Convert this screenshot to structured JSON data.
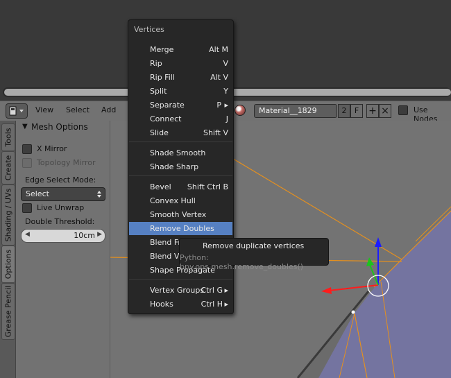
{
  "header": {
    "view_label": "View",
    "select_label": "Select",
    "add_label": "Add",
    "material_name": "Material__1829",
    "material_users": "2",
    "fake_user": "F",
    "new_material": "+",
    "unlink": "×",
    "use_nodes_label": "Use Nodes"
  },
  "tabs": [
    "Tools",
    "Create",
    "Shading / UVs",
    "Options",
    "Grease Pencil"
  ],
  "tool_panel": {
    "panel_title": "Mesh Options",
    "x_mirror": "X Mirror",
    "topology_mirror": "Topology Mirror",
    "edge_select_label": "Edge Select Mode:",
    "edge_select_value": "Select",
    "live_unwrap": "Live Unwrap",
    "double_threshold_label": "Double Threshold:",
    "double_threshold_value": "10cm"
  },
  "menu": {
    "title": "Vertices",
    "items": [
      {
        "label": "Merge",
        "shortcut": "Alt M"
      },
      {
        "label": "Rip",
        "shortcut": "V"
      },
      {
        "label": "Rip Fill",
        "shortcut": "Alt V"
      },
      {
        "label": "Split",
        "shortcut": "Y"
      },
      {
        "label": "Separate",
        "shortcut": "P"
      },
      {
        "label": "Connect",
        "shortcut": "J"
      },
      {
        "label": "Slide",
        "shortcut": "Shift V"
      },
      {
        "label": "Shade Smooth",
        "shortcut": ""
      },
      {
        "label": "Shade Sharp",
        "shortcut": ""
      },
      {
        "label": "Bevel",
        "shortcut": "Shift Ctrl B"
      },
      {
        "label": "Convex Hull",
        "shortcut": ""
      },
      {
        "label": "Smooth Vertex",
        "shortcut": ""
      },
      {
        "label": "Remove Doubles",
        "shortcut": ""
      },
      {
        "label": "Blend From Shape",
        "shortcut": ""
      },
      {
        "label": "Blend Vertex",
        "shortcut": ""
      },
      {
        "label": "Shape Propagate",
        "shortcut": ""
      },
      {
        "label": "Vertex Groups",
        "shortcut": "Ctrl G"
      },
      {
        "label": "Hooks",
        "shortcut": "Ctrl H"
      }
    ],
    "submenu_arrow": "▸"
  },
  "tooltip": {
    "description": "Remove duplicate vertices",
    "python": "Python: bpy.ops.mesh.remove_doubles()"
  },
  "colors": {
    "menu_bg": "#272727",
    "highlight": "#5680c2",
    "viewport": "#737373",
    "mesh_face": "#7474a0",
    "edge_orange": "#e5901e"
  }
}
